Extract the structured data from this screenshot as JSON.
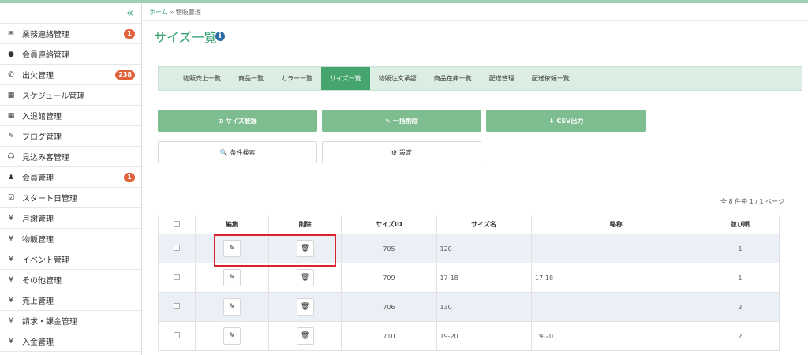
{
  "sidebar": {
    "collapse_glyph": "«",
    "items": [
      {
        "icon": "envelope-icon",
        "glyph": "✉",
        "label": "業務連絡管理",
        "badge": "1"
      },
      {
        "icon": "comment-icon",
        "glyph": "●",
        "label": "会員連絡管理",
        "badge": ""
      },
      {
        "icon": "phone-icon",
        "glyph": "✆",
        "label": "出欠管理",
        "badge": "238"
      },
      {
        "icon": "calendar-icon",
        "glyph": "▦",
        "label": "スケジュール管理",
        "badge": ""
      },
      {
        "icon": "calendar-icon",
        "glyph": "▦",
        "label": "入退館管理",
        "badge": ""
      },
      {
        "icon": "pencil-icon",
        "glyph": "✎",
        "label": "ブログ管理",
        "badge": ""
      },
      {
        "icon": "smile-icon",
        "glyph": "☺",
        "label": "見込み客管理",
        "badge": ""
      },
      {
        "icon": "user-icon",
        "glyph": "♟",
        "label": "会員管理",
        "badge": "1"
      },
      {
        "icon": "check-square-icon",
        "glyph": "☑",
        "label": "スタート日管理",
        "badge": ""
      },
      {
        "icon": "yen-icon",
        "glyph": "¥",
        "label": "月謝管理",
        "badge": ""
      },
      {
        "icon": "yen-icon",
        "glyph": "¥",
        "label": "物販管理",
        "badge": ""
      },
      {
        "icon": "yen-icon",
        "glyph": "¥",
        "label": "イベント管理",
        "badge": ""
      },
      {
        "icon": "yen-icon",
        "glyph": "¥",
        "label": "その他管理",
        "badge": ""
      },
      {
        "icon": "yen-icon",
        "glyph": "¥",
        "label": "売上管理",
        "badge": ""
      },
      {
        "icon": "yen-icon",
        "glyph": "¥",
        "label": "請求・課金管理",
        "badge": ""
      },
      {
        "icon": "yen-icon",
        "glyph": "¥",
        "label": "入金管理",
        "badge": ""
      }
    ]
  },
  "breadcrumb": {
    "home": "ホーム",
    "sep": "»",
    "current": "物販管理"
  },
  "page": {
    "title": "サイズ一覧",
    "info_glyph": "i"
  },
  "tabs": [
    {
      "label": "物販売上一覧",
      "active": false
    },
    {
      "label": "商品一覧",
      "active": false
    },
    {
      "label": "カラー一覧",
      "active": false
    },
    {
      "label": "サイズ一覧",
      "active": true
    },
    {
      "label": "物販注文承認",
      "active": false
    },
    {
      "label": "商品在庫一覧",
      "active": false
    },
    {
      "label": "配送管理",
      "active": false
    },
    {
      "label": "配送依頼一覧",
      "active": false
    }
  ],
  "actions": {
    "register": {
      "glyph": "⊕",
      "label": "サイズ登録"
    },
    "bulk_delete": {
      "glyph": "✎",
      "label": "一括削除"
    },
    "csv": {
      "glyph": "⬇",
      "label": "CSV出力"
    },
    "search": {
      "glyph": "🔍",
      "label": "条件検索"
    },
    "settings": {
      "glyph": "⚙",
      "label": "設定"
    }
  },
  "pageinfo": "全 8 件中 1 / 1 ページ",
  "table": {
    "headers": [
      "",
      "編集",
      "削除",
      "サイズID",
      "サイズ名",
      "略称",
      "並び順"
    ],
    "edit_glyph": "✎",
    "delete_glyph": "🗑",
    "rows": [
      {
        "id": "705",
        "name": "120",
        "abbr": "",
        "order": "1"
      },
      {
        "id": "709",
        "name": "17-18",
        "abbr": "17-18",
        "order": "1"
      },
      {
        "id": "706",
        "name": "130",
        "abbr": "",
        "order": "2"
      },
      {
        "id": "710",
        "name": "19-20",
        "abbr": "19-20",
        "order": "2"
      }
    ]
  },
  "colors": {
    "accent": "#46a56f",
    "badge": "#e0623a",
    "highlight": "#d9232e"
  }
}
